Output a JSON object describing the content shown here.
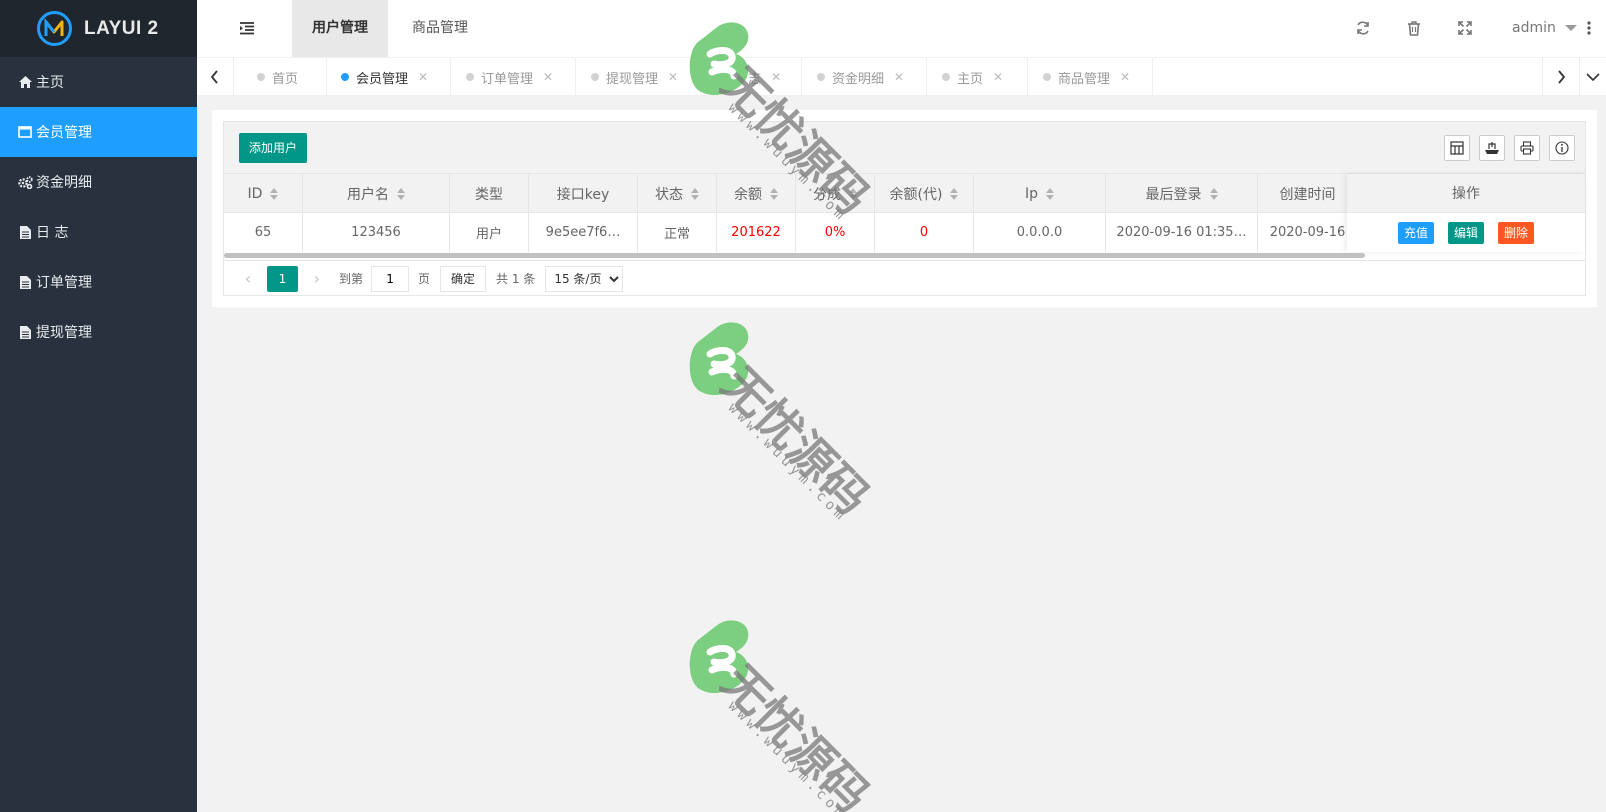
{
  "brand": {
    "title": "LAYUI 2"
  },
  "sidebar": {
    "items": [
      {
        "label": "主页",
        "icon": "home-icon"
      },
      {
        "label": "会员管理",
        "icon": "window-icon",
        "active": true
      },
      {
        "label": "资金明细",
        "icon": "gears-icon"
      },
      {
        "label": "日 志",
        "icon": "file-icon"
      },
      {
        "label": "订单管理",
        "icon": "file-icon"
      },
      {
        "label": "提现管理",
        "icon": "file-icon"
      }
    ]
  },
  "header": {
    "tabs": [
      {
        "label": "用户管理",
        "active": true
      },
      {
        "label": "商品管理"
      }
    ],
    "icons": [
      "refresh-icon",
      "trash-icon",
      "fullscreen-icon"
    ],
    "user": "admin"
  },
  "page_tabs": [
    {
      "label": "首页",
      "closable": false
    },
    {
      "label": "会员管理",
      "active": true,
      "closable": true
    },
    {
      "label": "订单管理",
      "closable": true
    },
    {
      "label": "提现管理",
      "closable": true
    },
    {
      "label": "日 志",
      "closable": true
    },
    {
      "label": "资金明细",
      "closable": true
    },
    {
      "label": "主页",
      "closable": true
    },
    {
      "label": "商品管理",
      "closable": true
    }
  ],
  "toolbar": {
    "add_label": "添加用户",
    "icons": [
      "columns-icon",
      "export-icon",
      "print-icon",
      "info-icon"
    ]
  },
  "table": {
    "columns": [
      "ID",
      "用户名",
      "类型",
      "接口key",
      "状态",
      "余额",
      "分成",
      "余额(代)",
      "Ip",
      "最后登录",
      "创建时间",
      "操作"
    ],
    "rows": [
      {
        "id": "65",
        "username": "123456",
        "type": "用户",
        "key": "9e5ee7f6…",
        "status": "正常",
        "balance": "201622",
        "share": "0%",
        "agent_balance": "0",
        "ip": "0.0.0.0",
        "last_login": "2020-09-16 01:35…",
        "created": "2020-09-16"
      }
    ],
    "actions": [
      {
        "label": "充值",
        "color": "#1e9fff"
      },
      {
        "label": "编辑",
        "color": "#009688"
      },
      {
        "label": "删除",
        "color": "#ff5722"
      }
    ]
  },
  "pager": {
    "current": "1",
    "goto_label": "到第",
    "page_input": "1",
    "page_suffix": "页",
    "confirm": "确定",
    "total": "共 1 条",
    "per_page": "15 条/页"
  },
  "watermark": {
    "text": "无忧源码",
    "url": "www.wuuym.com"
  },
  "colors": {
    "sidebar": "#28313d",
    "active": "#1e9fff",
    "primary": "#009688",
    "danger": "#ff5722",
    "watermark_green": "#7ccf80"
  }
}
